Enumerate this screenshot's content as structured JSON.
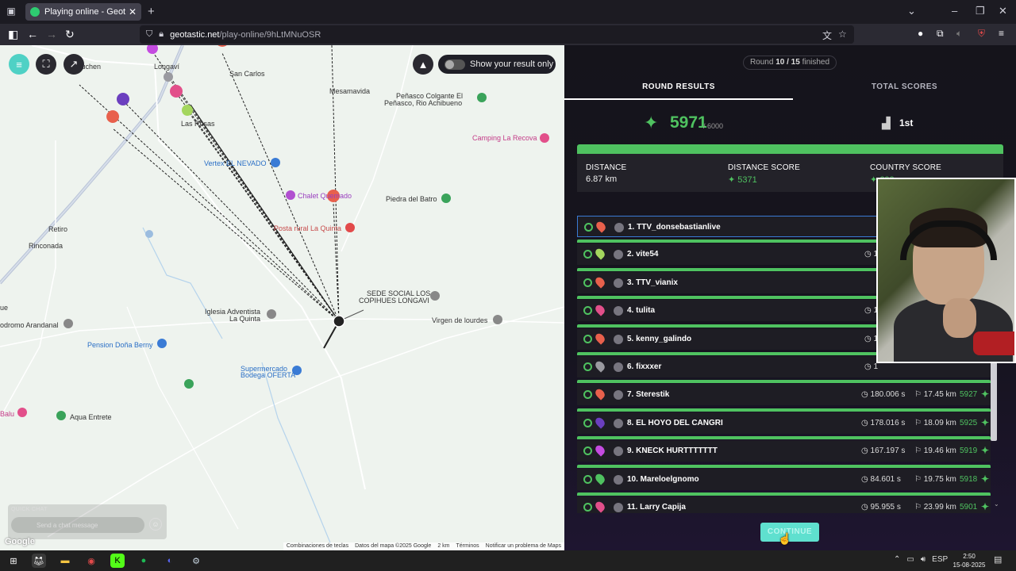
{
  "browser": {
    "tab_title": "Playing online - Geotastic",
    "new_tab": "+",
    "close_tab": "✕",
    "url_host": "geotastic.net",
    "url_path": "/play-online/9hLtMNuOSR"
  },
  "map": {
    "show_result_toggle": "Show your result only",
    "places": [
      {
        "label": "Longaví",
        "style": "poi-gray"
      },
      {
        "label": "San Carlos",
        "style": "poi-gray"
      },
      {
        "label": "Mesamavida",
        "style": "poi-gray"
      },
      {
        "label": "Peñasco Colgante El",
        "style": "poi-gray"
      },
      {
        "label": "Peñasco, Rio Achibueno",
        "style": "poi-gray"
      },
      {
        "label": "Camping La Recova",
        "style": "poi-pink"
      },
      {
        "label": "Las Rosas",
        "style": "poi-gray"
      },
      {
        "label": "Vertex EL NEVADO",
        "style": "poi-blue"
      },
      {
        "label": "Chalet Quemado",
        "style": "poi-purple"
      },
      {
        "label": "Piedra del Batro",
        "style": "poi-gray"
      },
      {
        "label": "Posta rural La Quinta",
        "style": "poi-red"
      },
      {
        "label": "Retiro",
        "style": "poi-gray"
      },
      {
        "label": "Rinconada",
        "style": "poi-gray"
      },
      {
        "label": "SEDE SOCIAL LOS",
        "style": "poi-gray"
      },
      {
        "label": "COPIHUES LONGAVI",
        "style": "poi-gray"
      },
      {
        "label": "Iglesia Adventista",
        "style": "poi-gray"
      },
      {
        "label": "La Quinta",
        "style": "poi-gray"
      },
      {
        "label": "Virgen de lourdes",
        "style": "poi-gray"
      },
      {
        "label": "odromo Arandanal",
        "style": "poi-gray"
      },
      {
        "label": "Pension Doña Berny",
        "style": "poi-blue"
      },
      {
        "label": "Supermercado",
        "style": "poi-blue"
      },
      {
        "label": "Bodega OFERTA",
        "style": "poi-blue"
      },
      {
        "label": "Aqua Entrete",
        "style": "poi-gray"
      },
      {
        "label": "Balu",
        "style": "poi-pink"
      },
      {
        "label": "ue",
        "style": "poi-gray"
      },
      {
        "label": "Caguchen",
        "style": "poi-gray"
      }
    ],
    "quick_chat_label": "QUICK CHAT",
    "quick_chat_placeholder": "Send a chat message",
    "google": "Google",
    "attribution": [
      "Combinaciones de teclas",
      "Datos del mapa ©2025 Google",
      "2 km",
      "Términos",
      "Notificar un problema de Maps"
    ]
  },
  "panel": {
    "round_prefix": "Round",
    "round_current": "10 / 15",
    "round_suffix": "finished",
    "tab_round": "ROUND RESULTS",
    "tab_total": "TOTAL SCORES",
    "score": "5971",
    "score_max": "/ 6000",
    "rank": "1st",
    "stats": {
      "distance_label": "DISTANCE",
      "distance_value": "6.87 km",
      "distance_score_label": "DISTANCE SCORE",
      "distance_score_value": "5371",
      "country_score_label": "COUNTRY SCORE",
      "country_score_value": "600"
    },
    "players": [
      {
        "rank": "1.",
        "name": "TTV_donsebastianlive",
        "time": "",
        "dist": "",
        "pts": "",
        "pin": "#e8604c",
        "selected": true
      },
      {
        "rank": "2.",
        "name": "vite54",
        "time": "1",
        "dist": "",
        "pts": "",
        "pin": "#a4d65e",
        "selected": false
      },
      {
        "rank": "3.",
        "name": "TTV_vianix",
        "time": "",
        "dist": "",
        "pts": "",
        "pin": "#e8604c",
        "selected": false
      },
      {
        "rank": "4.",
        "name": "tulita",
        "time": "1",
        "dist": "",
        "pts": "",
        "pin": "#e24f8a",
        "selected": false
      },
      {
        "rank": "5.",
        "name": "kenny_galindo",
        "time": "1",
        "dist": "",
        "pts": "",
        "pin": "#e8604c",
        "selected": false
      },
      {
        "rank": "6.",
        "name": "fixxxer",
        "time": "1",
        "dist": "",
        "pts": "",
        "pin": "#9a9aa0",
        "selected": false
      },
      {
        "rank": "7.",
        "name": "Sterestik",
        "time": "180.006 s",
        "dist": "17.45 km",
        "pts": "5927",
        "pin": "#e8604c",
        "selected": false
      },
      {
        "rank": "8.",
        "name": "EL HOYO DEL CANGRI",
        "time": "178.016 s",
        "dist": "18.09 km",
        "pts": "5925",
        "pin": "#6b3fbf",
        "selected": false
      },
      {
        "rank": "9.",
        "name": "KNECK HURTTTTTTT",
        "time": "167.197 s",
        "dist": "19.46 km",
        "pts": "5919",
        "pin": "#c44be0",
        "selected": false
      },
      {
        "rank": "10.",
        "name": "Mareloelgnomo",
        "time": "84.601 s",
        "dist": "19.75 km",
        "pts": "5918",
        "pin": "#4fc260",
        "selected": false
      },
      {
        "rank": "11.",
        "name": "Larry Capija",
        "time": "95.955 s",
        "dist": "23.99 km",
        "pts": "5901",
        "pin": "#e24f8a",
        "selected": false
      }
    ],
    "continue": "CONTINUE"
  },
  "taskbar": {
    "lang": "ESP",
    "time": "2:50",
    "date": "15-08-2025",
    "notifications": "1"
  }
}
